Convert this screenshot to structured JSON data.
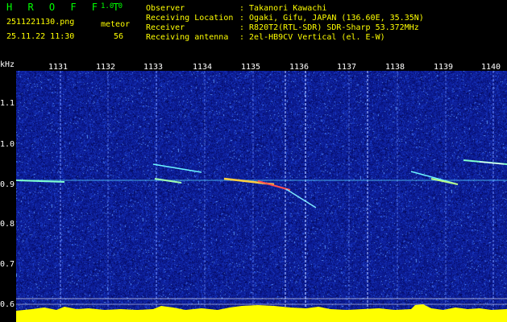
{
  "header": {
    "app_name": "H R O F F T",
    "version": "1.0.0",
    "filename": "2511221130.png",
    "datetime": "25.11.22 11:30",
    "meteor_label": "meteor",
    "meteor_count": "56",
    "info": [
      {
        "label": "Observer",
        "value": ": Takanori Kawachi"
      },
      {
        "label": "Receiving Location",
        "value": ": Ogaki, Gifu, JAPAN (136.60E, 35.35N)"
      },
      {
        "label": "Receiver",
        "value": ": R820T2(RTL-SDR) SDR-Sharp 53.372MHz"
      },
      {
        "label": "Receiving antenna",
        "value": ": 2el-HB9CV Vertical (el. E-W)"
      }
    ]
  },
  "x_unit": "kHz",
  "minute_ticks": [
    "1131",
    "1132",
    "1133",
    "1134",
    "1135",
    "1136",
    "1137",
    "1138",
    "1139",
    "1140"
  ],
  "freq_ticks": [
    "1.1",
    "1.0",
    "0.9",
    "0.8",
    "0.7",
    "0.6"
  ],
  "colors": {
    "background": "#000000",
    "spectrum_base": "#0a1a8c",
    "header_text": "#ffff00",
    "logo_text": "#00ff00",
    "tick_text": "#ffffff",
    "baseline": "#ffff00"
  }
}
